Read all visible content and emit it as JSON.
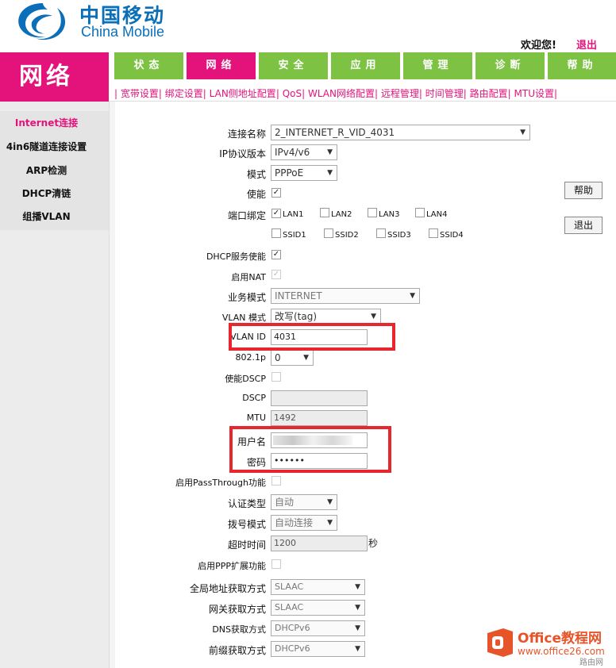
{
  "header": {
    "brand_cn": "中国移动",
    "brand_en": "China Mobile",
    "welcome": "欢迎您!",
    "logout": "退出"
  },
  "section_title": "网络",
  "menu": [
    {
      "label": "状态",
      "active": false
    },
    {
      "label": "网络",
      "active": true
    },
    {
      "label": "安全",
      "active": false
    },
    {
      "label": "应用",
      "active": false
    },
    {
      "label": "管理",
      "active": false
    },
    {
      "label": "诊断",
      "active": false
    },
    {
      "label": "帮助",
      "active": false
    }
  ],
  "submenu": [
    "宽带设置",
    "绑定设置",
    "LAN侧地址配置",
    "QoS",
    "WLAN网络配置",
    "远程管理",
    "时间管理",
    "路由配置",
    "MTU设置"
  ],
  "sidebar": [
    {
      "label": "Internet连接",
      "active": true
    },
    {
      "label": "4in6隧道连接设置",
      "active": false
    },
    {
      "label": "ARP检测",
      "active": false
    },
    {
      "label": "DHCP清链",
      "active": false
    },
    {
      "label": "组播VLAN",
      "active": false
    }
  ],
  "form": {
    "conn_name_label": "连接名称",
    "conn_name_value": "2_INTERNET_R_VID_4031",
    "ip_version_label": "IP协议版本",
    "ip_version_value": "IPv4/v6",
    "mode_label": "模式",
    "mode_value": "PPPoE",
    "enable_label": "使能",
    "port_bind_label": "端口绑定",
    "ports": [
      "LAN1",
      "LAN2",
      "LAN3",
      "LAN4",
      "SSID1",
      "SSID2",
      "SSID3",
      "SSID4"
    ],
    "dhcp_label": "DHCP服务使能",
    "nat_label": "启用NAT",
    "service_mode_label": "业务模式",
    "service_mode_value": "INTERNET",
    "vlan_mode_label": "VLAN 模式",
    "vlan_mode_value": "改写(tag)",
    "vlan_id_label": "VLAN ID",
    "vlan_id_value": "4031",
    "dot1p_label": "802.1p",
    "dot1p_value": "0",
    "dscp_enable_label": "使能DSCP",
    "dscp_label": "DSCP",
    "mtu_label": "MTU",
    "mtu_value": "1492",
    "username_label": "用户名",
    "password_label": "密码",
    "password_value": "••••••",
    "passthrough_label": "启用PassThrough功能",
    "auth_type_label": "认证类型",
    "auth_type_value": "自动",
    "dial_mode_label": "拨号模式",
    "dial_mode_value": "自动连接",
    "timeout_label": "超时时间",
    "timeout_value": "1200",
    "timeout_unit": "秒",
    "ppp_ext_label": "启用PPP扩展功能",
    "global_addr_label": "全局地址获取方式",
    "global_addr_value": "SLAAC",
    "gateway_label": "网关获取方式",
    "gateway_value": "SLAAC",
    "dns_label": "DNS获取方式",
    "dns_value": "DHCPv6",
    "prefix_label": "前缀获取方式",
    "prefix_value": "DHCPv6"
  },
  "buttons": {
    "help": "帮助",
    "logout": "退出"
  },
  "watermark": {
    "title": "Office教程网",
    "url": "www.office26.com",
    "tag": "路由网"
  },
  "colors": {
    "brand_magenta": "#e4137b",
    "menu_green": "#7dc242",
    "brand_blue": "#0a6fb8",
    "highlight_red": "#e8262e"
  }
}
